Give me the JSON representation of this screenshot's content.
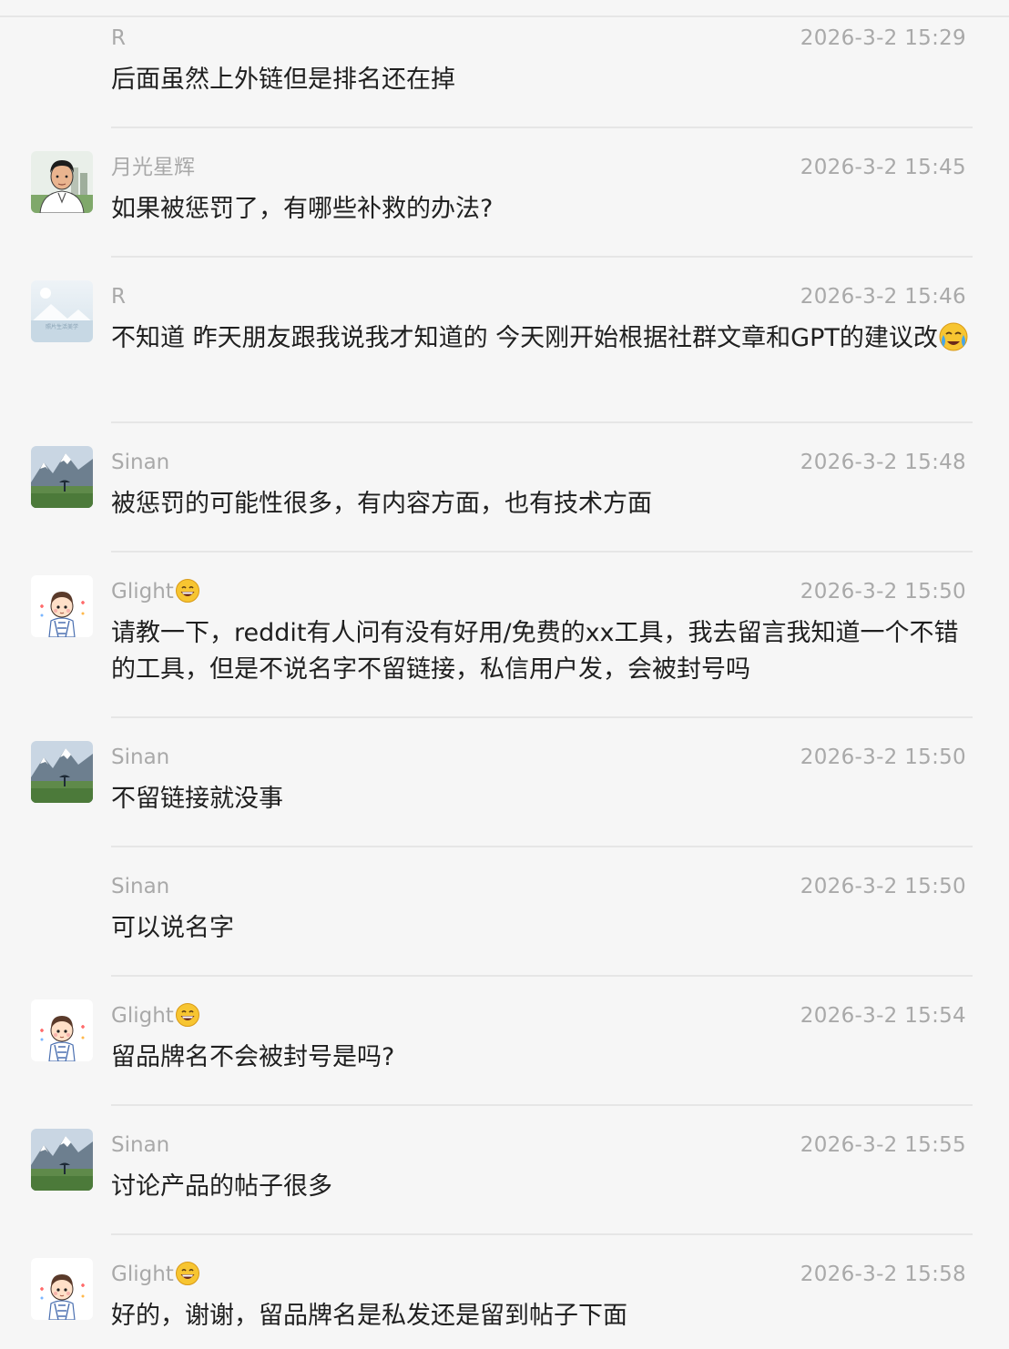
{
  "messages": [
    {
      "sender": "R",
      "avatar": "",
      "time": "2026-3-2 15:29",
      "text": "后面虽然上外链但是排名还在掉"
    },
    {
      "sender": "月光星辉",
      "avatar": "man-portrait-avatar",
      "time": "2026-3-2 15:45",
      "text": "如果被惩罚了，有哪些补救的办法?"
    },
    {
      "sender": "R",
      "avatar": "placeholder-image-avatar",
      "time": "2026-3-2 15:46",
      "text": "不知道  昨天朋友跟我说我才知道的  今天刚开始根据社群文章和GPT的建议改",
      "text_emoji": "crying-face"
    },
    {
      "sender": "Sinan",
      "avatar": "mountain-landscape-avatar",
      "time": "2026-3-2 15:48",
      "text": "被惩罚的可能性很多，有内容方面，也有技术方面"
    },
    {
      "sender": "Glight",
      "sender_emoji": "grinning-face",
      "avatar": "cartoon-boy-avatar",
      "time": "2026-3-2 15:50",
      "text": "请教一下，reddit有人问有没有好用/免费的xx工具，我去留言我知道一个不错的工具，但是不说名字不留链接，私信用户发，会被封号吗"
    },
    {
      "sender": "Sinan",
      "avatar": "mountain-landscape-avatar",
      "time": "2026-3-2 15:50",
      "text": "不留链接就没事"
    },
    {
      "sender": "Sinan",
      "avatar": "",
      "time": "2026-3-2 15:50",
      "text": "可以说名字"
    },
    {
      "sender": "Glight",
      "sender_emoji": "grinning-face",
      "avatar": "cartoon-boy-avatar",
      "time": "2026-3-2 15:54",
      "text": "留品牌名不会被封号是吗?"
    },
    {
      "sender": "Sinan",
      "avatar": "mountain-landscape-avatar",
      "time": "2026-3-2 15:55",
      "text": "讨论产品的帖子很多"
    },
    {
      "sender": "Glight",
      "sender_emoji": "grinning-face",
      "avatar": "cartoon-boy-avatar",
      "time": "2026-3-2 15:58",
      "text": "好的，谢谢，留品牌名是私发还是留到帖子下面"
    }
  ],
  "avatar_caption": "照片生活美学",
  "colors": {
    "background": "#f6f6f6",
    "meta_text": "#a9a9a9",
    "body_text": "#1f1f1f",
    "divider": "#e6e6e6"
  }
}
